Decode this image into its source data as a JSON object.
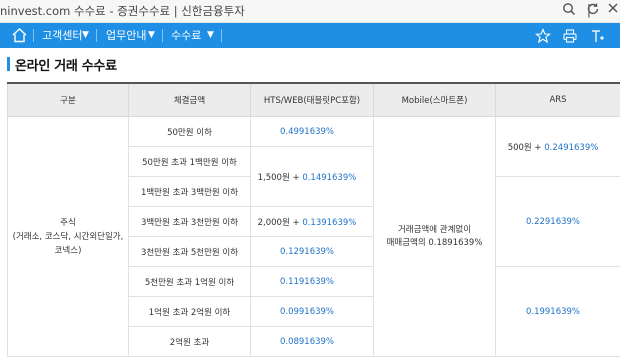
{
  "topbar": {
    "title": "ninvest.com 수수료 - 증권수수료 | 신한금융투자"
  },
  "nav": {
    "items": [
      {
        "label": "고객센터"
      },
      {
        "label": "업무안내"
      },
      {
        "label": "수수료"
      }
    ]
  },
  "section": {
    "title": "온라인 거래 수수료"
  },
  "table": {
    "headers": [
      "구분",
      "체결금액",
      "HTS/WEB(태블릿PC포함)",
      "Mobile(스마트폰)",
      "ARS"
    ],
    "category_lines": [
      "주식",
      "(거래소, 코스닥, 시간외단일가,",
      "코넥스)"
    ],
    "amounts": [
      "50만원 이하",
      "50만원 초과 1백만원 이하",
      "1백만원 초과 3백만원 이하",
      "3백만원 초과 3천만원 이하",
      "3천만원 초과 5천만원 이하",
      "5천만원 초과 1억원 이하",
      "1억원 초과 2억원 이하",
      "2억원 초과"
    ],
    "hts": [
      {
        "rate": "0.4991639%"
      },
      {
        "prefix": "1,500원 + ",
        "rate": "0.1491639%"
      },
      {
        "prefix": "2,000원 + ",
        "rate": "0.1391639%"
      },
      {
        "rate": "0.1291639%"
      },
      {
        "rate": "0.1191639%"
      },
      {
        "rate": "0.0991639%"
      },
      {
        "rate": "0.0891639%"
      }
    ],
    "mobile_lines": [
      "거래금액에 관계없이",
      "매매금액의 0.1891639%"
    ],
    "ars": [
      {
        "prefix": "500원 + ",
        "rate": "0.2491639%"
      },
      {
        "rate": "0.2291639%"
      },
      {
        "rate": "0.1991639%"
      }
    ]
  }
}
